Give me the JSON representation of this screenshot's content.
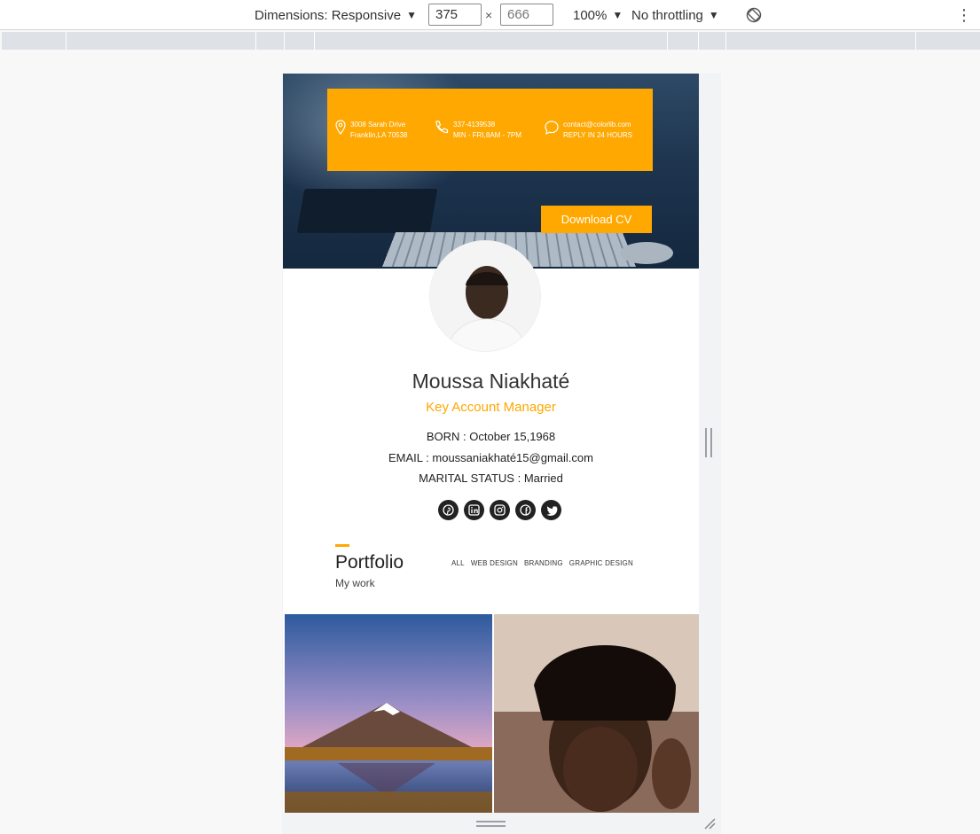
{
  "devtools": {
    "dimensions_label": "Dimensions: Responsive",
    "width_value": "375",
    "height_value": "666",
    "times": "×",
    "zoom": "100%",
    "throttling": "No throttling",
    "caret": "▼",
    "more": "⋮"
  },
  "page": {
    "contacts": [
      {
        "icon": "location-pin-icon",
        "line1": "3008 Sarah Drive",
        "line2": "Franklin,LA 70538"
      },
      {
        "icon": "phone-icon",
        "line1": "337-4139538",
        "line2": "MIN - FRI,8AM - 7PM"
      },
      {
        "icon": "chat-bubble-icon",
        "line1": "contact@colorlib.com",
        "line2": "REPLY IN 24 HOURS"
      }
    ],
    "download_label": "Download CV",
    "name": "Moussa Niakhaté",
    "role": "Key Account Manager",
    "born_label": "BORN :",
    "born_value": " October 15,1968",
    "email_label": "EMAIL :",
    "email_value": " moussaniakhaté15@gmail.com",
    "marital_label": "MARITAL STATUS :",
    "marital_value": " Married",
    "social": [
      "pinterest-icon",
      "linkedin-icon",
      "instagram-icon",
      "facebook-icon",
      "twitter-icon"
    ],
    "portfolio": {
      "title": "Portfolio",
      "subtitle": "My work",
      "filters": [
        "ALL",
        "WEB DESIGN",
        "BRANDING",
        "GRAPHIC DESIGN"
      ]
    }
  },
  "colors": {
    "accent": "#fea801",
    "dark": "#222222"
  }
}
